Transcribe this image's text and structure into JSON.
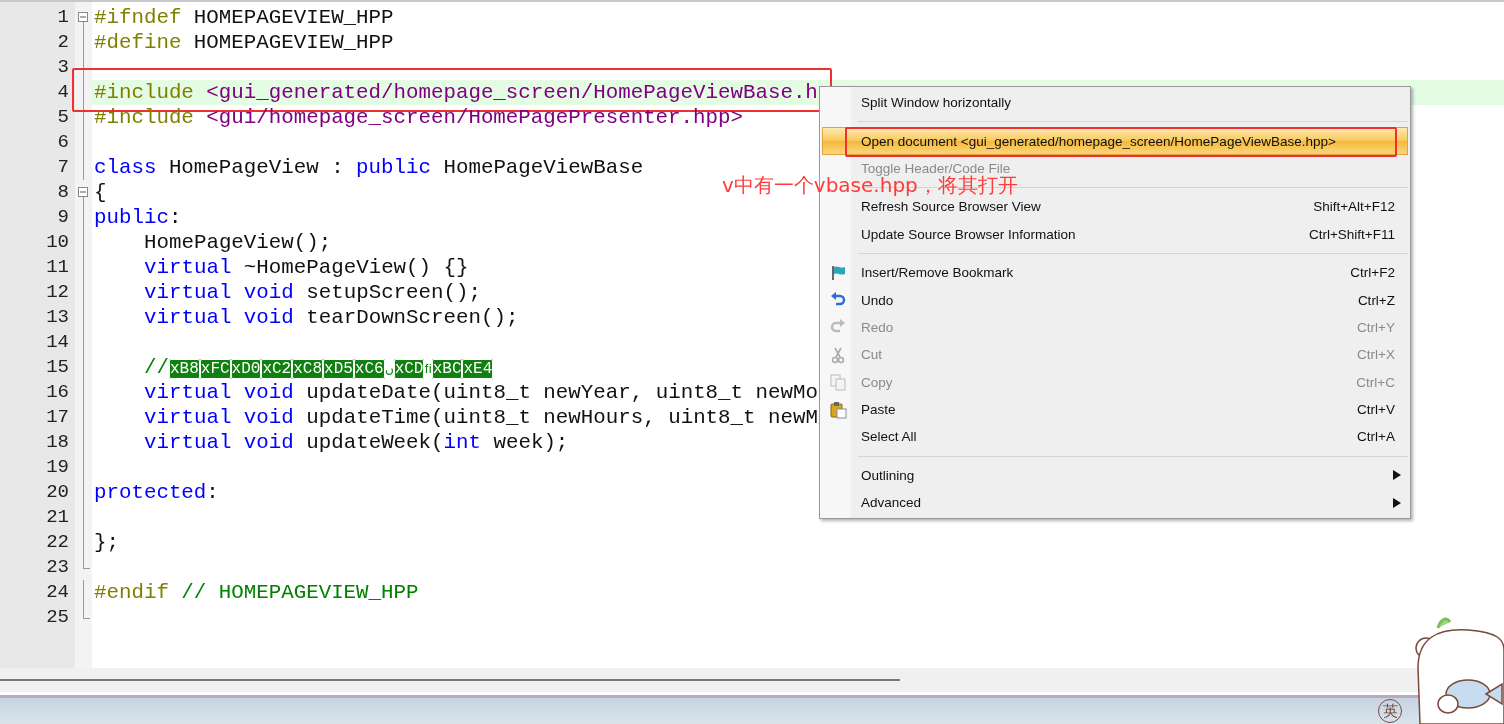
{
  "editor": {
    "lines": [
      {
        "number": "1",
        "collapsible": true,
        "tokens": [
          {
            "kind": "pp",
            "text": "#ifndef"
          },
          {
            "kind": "plain",
            "text": " HOMEPAGEVIEW_HPP"
          }
        ]
      },
      {
        "number": "2",
        "tokens": [
          {
            "kind": "pp",
            "text": "#define"
          },
          {
            "kind": "plain",
            "text": " HOMEPAGEVIEW_HPP"
          }
        ]
      },
      {
        "number": "3"
      },
      {
        "number": "4",
        "current": true,
        "marked": true,
        "tokens": [
          {
            "kind": "pp",
            "text": "#include"
          },
          {
            "kind": "str",
            "text": " <gui_generated/homepage_screen/HomePageViewBase.h"
          }
        ]
      },
      {
        "number": "5",
        "tokens": [
          {
            "kind": "pp",
            "text": "#include"
          },
          {
            "kind": "str",
            "text": " <gui/homepage_screen/HomePagePresenter.hpp>"
          }
        ]
      },
      {
        "number": "6"
      },
      {
        "number": "7",
        "tokens": [
          {
            "kind": "kw",
            "text": "class"
          },
          {
            "kind": "plain",
            "text": " HomePageView : "
          },
          {
            "kind": "kw",
            "text": "public"
          },
          {
            "kind": "plain",
            "text": " HomePageViewBase"
          }
        ]
      },
      {
        "number": "8",
        "collapsible": true,
        "tokens": [
          {
            "kind": "plain",
            "text": "{"
          }
        ]
      },
      {
        "number": "9",
        "tokens": [
          {
            "kind": "kw",
            "text": "public"
          },
          {
            "kind": "plain",
            "text": ":"
          }
        ]
      },
      {
        "number": "10",
        "indented": true,
        "tokens": [
          {
            "kind": "plain",
            "text": "HomePageView();"
          }
        ]
      },
      {
        "number": "11",
        "indented": true,
        "tokens": [
          {
            "kind": "kw",
            "text": "virtual"
          },
          {
            "kind": "plain",
            "text": " ~HomePageView() {}"
          }
        ]
      },
      {
        "number": "12",
        "indented": true,
        "tokens": [
          {
            "kind": "kw",
            "text": "virtual void"
          },
          {
            "kind": "plain",
            "text": " setupScreen();"
          }
        ]
      },
      {
        "number": "13",
        "indented": true,
        "tokens": [
          {
            "kind": "kw",
            "text": "virtual void"
          },
          {
            "kind": "plain",
            "text": " tearDownScreen();"
          }
        ]
      },
      {
        "number": "14"
      },
      {
        "number": "15",
        "indented": true,
        "tokens": [
          {
            "kind": "cm",
            "text": "//"
          },
          {
            "kind": "ctrl",
            "text": "xB8"
          },
          {
            "kind": "ctrl",
            "text": "xFC"
          },
          {
            "kind": "ctrl",
            "text": "xD0"
          },
          {
            "kind": "ctrl",
            "text": "xC2"
          },
          {
            "kind": "ctrl",
            "text": "xC8"
          },
          {
            "kind": "ctrl",
            "text": "xD5"
          },
          {
            "kind": "ctrl",
            "text": "xC6"
          },
          {
            "kind": "cm",
            "text": "ں"
          },
          {
            "kind": "ctrl",
            "text": "xCD"
          },
          {
            "kind": "cm",
            "text": "ﬁ"
          },
          {
            "kind": "ctrl",
            "text": "xBC"
          },
          {
            "kind": "ctrl",
            "text": "xE4"
          }
        ]
      },
      {
        "number": "16",
        "indented": true,
        "tokens": [
          {
            "kind": "kw",
            "text": "virtual void"
          },
          {
            "kind": "plain",
            "text": " updateDate(uint8_t newYear, uint8_t newMo"
          }
        ]
      },
      {
        "number": "17",
        "indented": true,
        "tokens": [
          {
            "kind": "kw",
            "text": "virtual void"
          },
          {
            "kind": "plain",
            "text": " updateTime(uint8_t newHours, uint8_t newM"
          }
        ]
      },
      {
        "number": "18",
        "indented": true,
        "tokens": [
          {
            "kind": "kw",
            "text": "virtual void"
          },
          {
            "kind": "plain",
            "text": " updateWeek("
          },
          {
            "kind": "kw",
            "text": "int"
          },
          {
            "kind": "plain",
            "text": " week);"
          }
        ]
      },
      {
        "number": "19"
      },
      {
        "number": "20",
        "tokens": [
          {
            "kind": "kw",
            "text": "protected"
          },
          {
            "kind": "plain",
            "text": ":"
          }
        ]
      },
      {
        "number": "21"
      },
      {
        "number": "22",
        "tokens": [
          {
            "kind": "plain",
            "text": "};"
          }
        ]
      },
      {
        "number": "23",
        "block_end": true
      },
      {
        "number": "24",
        "tokens": [
          {
            "kind": "pp",
            "text": "#endif"
          },
          {
            "kind": "cm",
            "text": " // HOMEPAGEVIEW_HPP"
          }
        ]
      },
      {
        "number": "25",
        "block_end": true
      }
    ]
  },
  "context_menu": {
    "items": [
      {
        "kind": "item",
        "label": "Split Window horizontally",
        "disabled": false,
        "selected": false
      },
      {
        "kind": "separator"
      },
      {
        "kind": "item",
        "label": "Open document <gui_generated/homepage_screen/HomePageViewBase.hpp>",
        "disabled": false,
        "selected": true,
        "marked": true
      },
      {
        "kind": "item",
        "label": "Toggle Header/Code File",
        "disabled": true,
        "selected": false
      },
      {
        "kind": "separator"
      },
      {
        "kind": "item",
        "label": "Refresh Source Browser View",
        "shortcut": "Shift+Alt+F12",
        "disabled": false,
        "selected": false
      },
      {
        "kind": "item",
        "label": "Update Source Browser Information",
        "shortcut": "Ctrl+Shift+F11",
        "disabled": false,
        "selected": false
      },
      {
        "kind": "separator"
      },
      {
        "kind": "item",
        "label": "Insert/Remove Bookmark",
        "shortcut": "Ctrl+F2",
        "disabled": false,
        "selected": false
      },
      {
        "kind": "item",
        "label": "Undo",
        "shortcut": "Ctrl+Z",
        "disabled": false,
        "selected": false
      },
      {
        "kind": "item",
        "label": "Redo",
        "shortcut": "Ctrl+Y",
        "disabled": true,
        "selected": false
      },
      {
        "kind": "item",
        "label": "Cut",
        "shortcut": "Ctrl+X",
        "disabled": true,
        "selected": false
      },
      {
        "kind": "item",
        "label": "Copy",
        "shortcut": "Ctrl+C",
        "disabled": true,
        "selected": false
      },
      {
        "kind": "item",
        "label": "Paste",
        "shortcut": "Ctrl+V",
        "disabled": false,
        "selected": false
      },
      {
        "kind": "item",
        "label": "Select All",
        "shortcut": "Ctrl+A",
        "disabled": false,
        "selected": false
      },
      {
        "kind": "separator"
      },
      {
        "kind": "submenu",
        "label": "Outlining",
        "disabled": false,
        "selected": false
      },
      {
        "kind": "submenu",
        "label": "Advanced",
        "disabled": false,
        "selected": false
      }
    ]
  },
  "annotation": {
    "text": "v中有一个vbase.hpp，将其打开"
  },
  "taskbar": {
    "ime_indicator": "英"
  }
}
